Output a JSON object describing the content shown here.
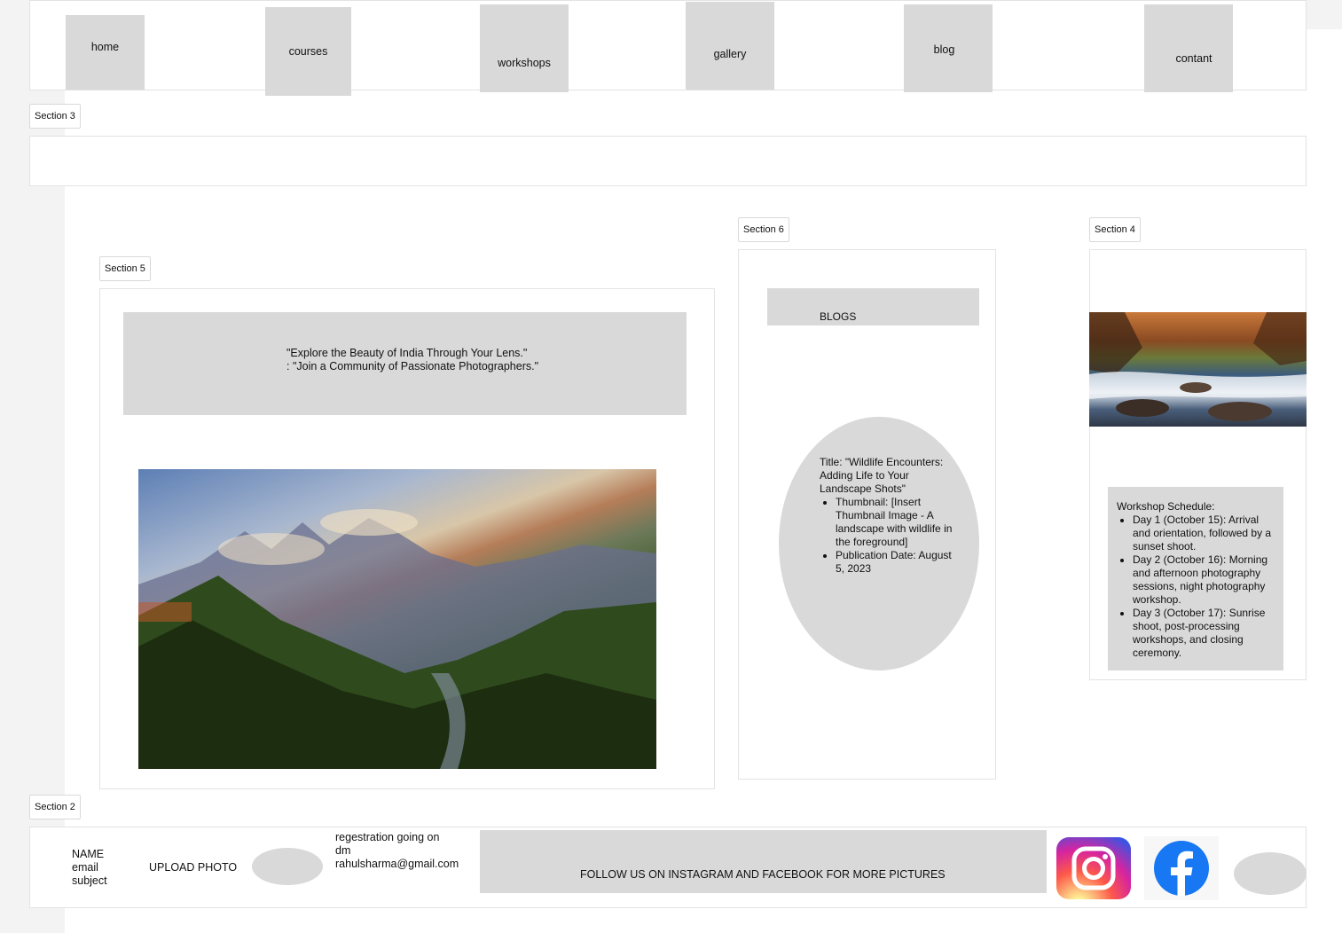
{
  "nav": {
    "items": [
      "home",
      "courses",
      "workshops",
      "gallery",
      "blog",
      "contant"
    ]
  },
  "sections": {
    "section3": "Section 3",
    "section5": "Section 5",
    "section6": "Section 6",
    "section4": "Section 4",
    "section2": "Section 2"
  },
  "hero": {
    "line1": "\"Explore the Beauty of India Through Your Lens.\"",
    "line2": ": \"Join a Community of Passionate Photographers.\""
  },
  "blogs": {
    "header": "BLOGS",
    "title": "Title: \"Wildlife Encounters: Adding Life to Your Landscape Shots\"",
    "bullets": [
      "Thumbnail: [Insert Thumbnail Image - A landscape with wildlife in the foreground]",
      "Publication Date: August 5, 2023"
    ]
  },
  "workshop": {
    "heading": "Workshop Schedule:",
    "days": [
      "Day 1 (October 15): Arrival and orientation, followed by a sunset shoot.",
      "Day 2 (October 16): Morning and afternoon photography sessions, night photography workshop.",
      "Day 3 (October 17): Sunrise shoot, post-processing workshops, and closing ceremony."
    ]
  },
  "footer": {
    "form_fields": [
      "NAME",
      "email",
      "subject"
    ],
    "upload_label": "UPLOAD PHOTO",
    "registration": [
      "regestration going on",
      "dm",
      "rahulsharma@gmail.com"
    ],
    "follow_text": "FOLLOW US ON INSTAGRAM AND FACEBOOK FOR MORE PICTURES"
  },
  "icons": {
    "instagram": "instagram-icon",
    "facebook": "facebook-icon"
  },
  "colors": {
    "placeholder_grey": "#d9d9d9",
    "facebook_blue": "#1877f2"
  }
}
